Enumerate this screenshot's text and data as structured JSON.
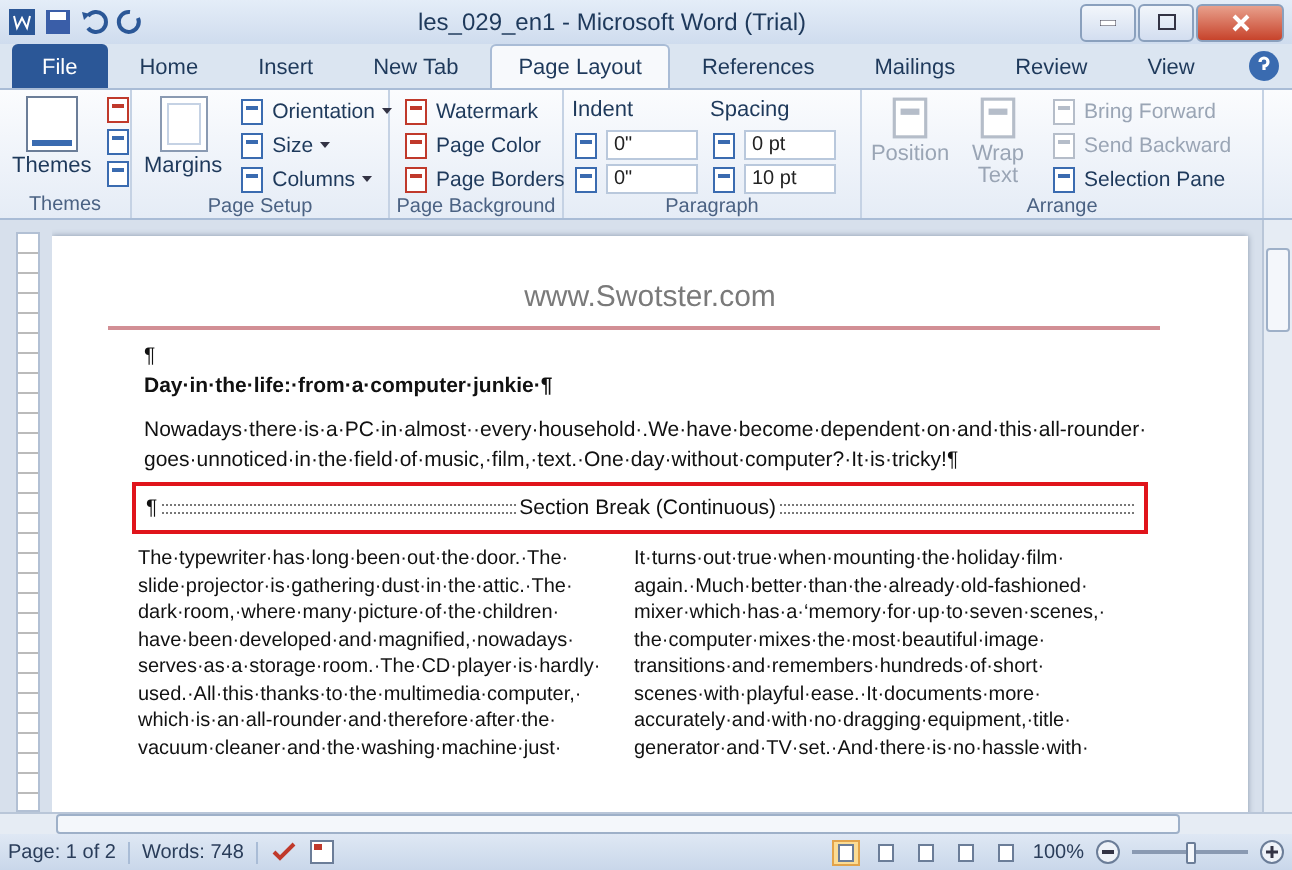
{
  "window": {
    "title": "les_029_en1  -  Microsoft Word (Trial)"
  },
  "tabs": [
    {
      "label": "File",
      "kind": "file",
      "selected": false
    },
    {
      "label": "Home",
      "kind": "tab",
      "selected": false
    },
    {
      "label": "Insert",
      "kind": "tab",
      "selected": false
    },
    {
      "label": "New Tab",
      "kind": "tab",
      "selected": false
    },
    {
      "label": "Page Layout",
      "kind": "tab",
      "selected": true
    },
    {
      "label": "References",
      "kind": "tab",
      "selected": false
    },
    {
      "label": "Mailings",
      "kind": "tab",
      "selected": false
    },
    {
      "label": "Review",
      "kind": "tab",
      "selected": false
    },
    {
      "label": "View",
      "kind": "tab",
      "selected": false
    }
  ],
  "ribbon": {
    "themes": {
      "label": "Themes",
      "group": "Themes"
    },
    "page_setup": {
      "big": "Margins",
      "items": [
        "Orientation",
        "Size",
        "Columns"
      ],
      "group": "Page Setup"
    },
    "page_background": {
      "items": [
        "Watermark",
        "Page Color",
        "Page Borders"
      ],
      "group": "Page Background"
    },
    "paragraph": {
      "indent_label": "Indent",
      "indent": [
        "0\"",
        "0\""
      ],
      "spacing_label": "Spacing",
      "spacing": [
        "0 pt",
        "10 pt"
      ],
      "group": "Paragraph"
    },
    "arrange": {
      "big": [
        {
          "label": "Position",
          "disabled": true
        },
        {
          "label": "Wrap Text",
          "disabled": true
        }
      ],
      "items": [
        {
          "label": "Bring Forward",
          "disabled": true
        },
        {
          "label": "Send Backward",
          "disabled": true
        },
        {
          "label": "Selection Pane",
          "disabled": false
        }
      ],
      "group": "Arrange"
    }
  },
  "document": {
    "header": "www.Swotster.com",
    "empty_mark": "¶",
    "title": "Day·in·the·life:·from·a·computer·junkie·¶",
    "paragraph": [
      "Nowadays·there·is·a·PC·in·almost··every·household·.We·have·become·dependent·on·and·this·all-rounder·",
      "goes·unnoticed·in·the·field·of·music,·film,·text.·One·day·without·computer?·It·is·tricky!¶"
    ],
    "section_break": {
      "mark": "¶",
      "label": "Section Break (Continuous)",
      "highlighted": true
    },
    "columns": [
      [
        "The·typewriter·has·long·been·out·the·door.·The·",
        "slide·projector·is·gathering·dust·in·the·attic.·The·",
        "dark·room,·where·many·picture·of·the·children·",
        "have·been·developed·and·magnified,·nowadays·",
        "serves·as·a·storage·room.·The·CD·player·is·hardly·",
        "used.·All·this·thanks·to·the·multimedia·computer,·",
        "which·is·an·all-rounder·and·therefore·after·the·",
        "vacuum·cleaner·and·the·washing·machine·just·"
      ],
      [
        "It·turns·out·true·when·mounting·the·holiday·film·",
        "again.·Much·better·than·the·already·old-fashioned·",
        "mixer·which·has·a·‘memory·for·up·to·seven·scenes,·",
        "the·computer·mixes·the·most·beautiful·image·",
        "transitions·and·remembers·hundreds·of·short·",
        "scenes·with·playful·ease.·It·documents·more·",
        "accurately·and·with·no·dragging·equipment,·title·",
        "generator·and·TV·set.·And·there·is·no·hassle·with·"
      ]
    ]
  },
  "status_bar": {
    "page": "Page: 1 of 2",
    "words": "Words: 748",
    "views": [
      {
        "selected": true
      },
      {
        "selected": false
      },
      {
        "selected": false
      },
      {
        "selected": false
      },
      {
        "selected": false
      }
    ],
    "zoom": "100%",
    "zoom_level": {
      "level": 0.5
    }
  }
}
